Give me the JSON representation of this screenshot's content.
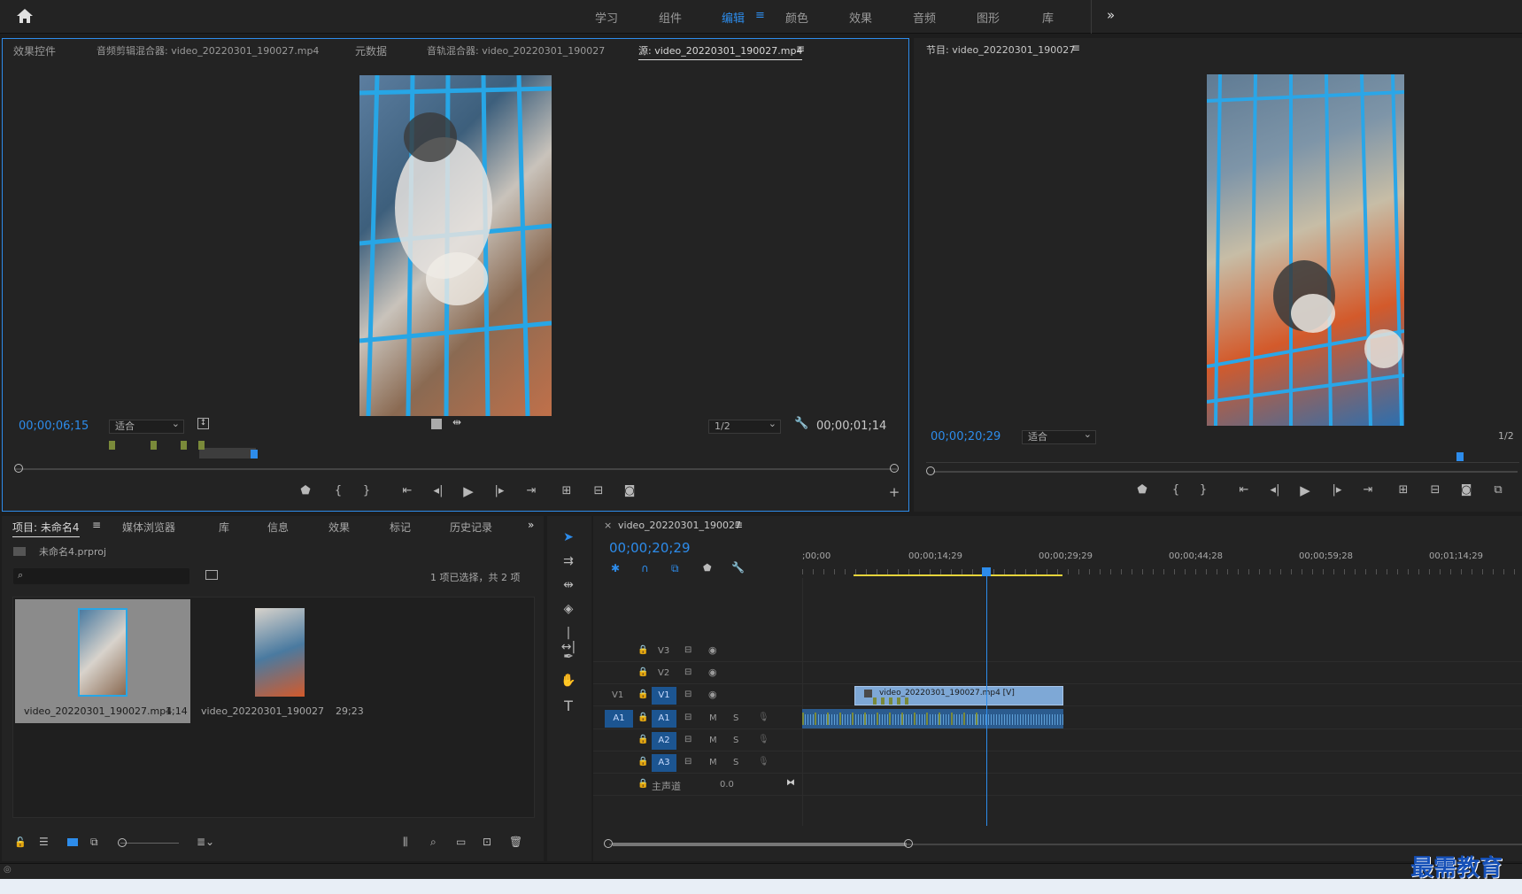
{
  "topbar": {
    "workspaces": [
      "学习",
      "组件",
      "编辑",
      "颜色",
      "效果",
      "音频",
      "图形",
      "库"
    ],
    "active_workspace": "编辑",
    "more": "»"
  },
  "source_panel": {
    "tabs": [
      "效果控件",
      "音频剪辑混合器: video_20220301_190027.mp4",
      "元数据",
      "音轨混合器: video_20220301_190027",
      "源: video_20220301_190027.mp4"
    ],
    "active_tab": "源: video_20220301_190027.mp4",
    "timecode_left": "00;00;06;15",
    "fit": "适合",
    "resolution": "1/2",
    "timecode_right": "00;00;01;14"
  },
  "program_panel": {
    "title": "节目: video_20220301_190027",
    "timecode": "00;00;20;29",
    "fit": "适合",
    "resolution": "1/2"
  },
  "project_panel": {
    "tabs": [
      "项目: 未命名4",
      "媒体浏览器",
      "库",
      "信息",
      "效果",
      "标记",
      "历史记录"
    ],
    "project_file": "未命名4.prproj",
    "selection_info": "1 项已选择，共 2 项",
    "items": [
      {
        "name": "video_20220301_190027.mp4",
        "duration": "1;14"
      },
      {
        "name": "video_20220301_190027",
        "duration": "29;23"
      }
    ]
  },
  "timeline": {
    "sequence_name": "video_20220301_190027",
    "timecode": "00;00;20;29",
    "ruler": [
      ";00;00",
      "00;00;14;29",
      "00;00;29;29",
      "00;00;44;28",
      "00;00;59;28",
      "00;01;14;29"
    ],
    "video_tracks": [
      "V3",
      "V2",
      "V1"
    ],
    "audio_tracks": [
      "A1",
      "A2",
      "A3"
    ],
    "master_label": "主声道",
    "master_value": "0.0",
    "clip_label": "video_20220301_190027.mp4 [V]",
    "mute": "M",
    "solo": "S"
  },
  "watermark": "最需教育"
}
